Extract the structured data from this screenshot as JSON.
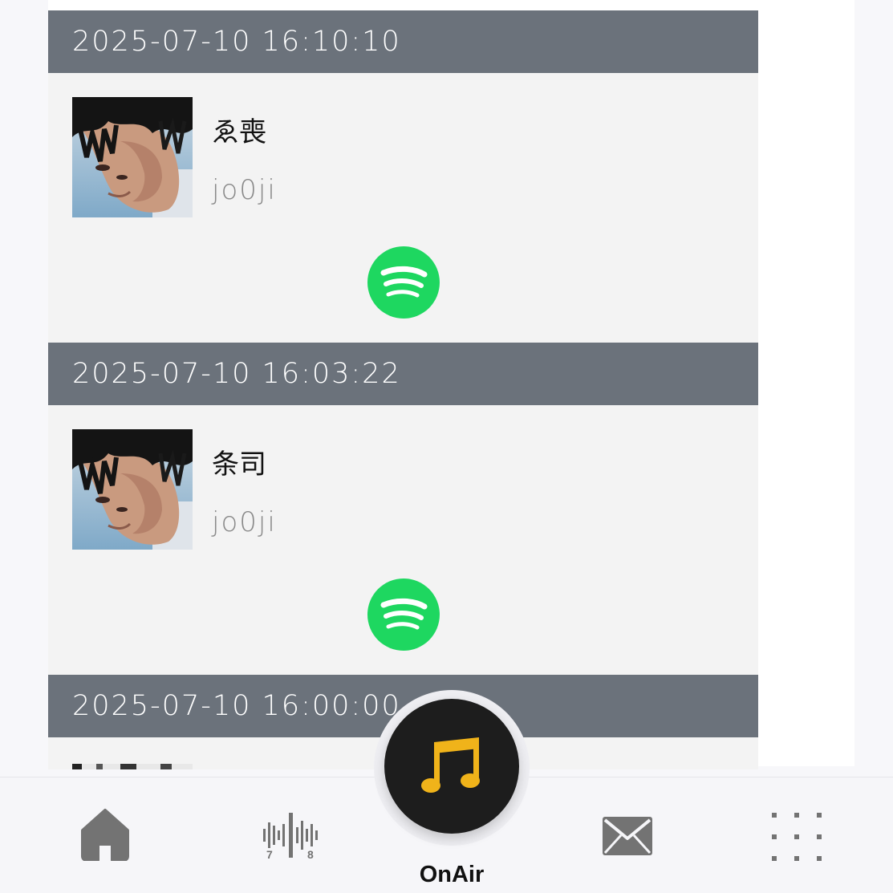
{
  "entries": [
    {
      "timestamp": "2025-07-10 16:10:10",
      "title": "ゑ喪",
      "artist": "jo0ji",
      "action_icon": "spotify-icon"
    },
    {
      "timestamp": "2025-07-10 16:03:22",
      "title": "条司",
      "artist": "jo0ji",
      "action_icon": "spotify-icon"
    },
    {
      "timestamp": "2025-07-10 16:00:00"
    }
  ],
  "nav": {
    "items": [
      {
        "name": "home",
        "icon": "home-icon"
      },
      {
        "name": "program",
        "icon": "waveform-icon",
        "caption_left": "7",
        "caption_right": "8"
      },
      {
        "name": "onair",
        "icon": "music-note-icon",
        "label": "OnAir"
      },
      {
        "name": "mail",
        "icon": "mail-icon"
      },
      {
        "name": "menu",
        "icon": "grid-dots-icon"
      }
    ]
  },
  "colors": {
    "header_bg": "#6b727b",
    "card_bg": "#f3f3f3",
    "spotify_green": "#1ed760",
    "onair_bg": "#1d1d1d",
    "onair_accent": "#f0b31a",
    "nav_icon": "#737373"
  }
}
